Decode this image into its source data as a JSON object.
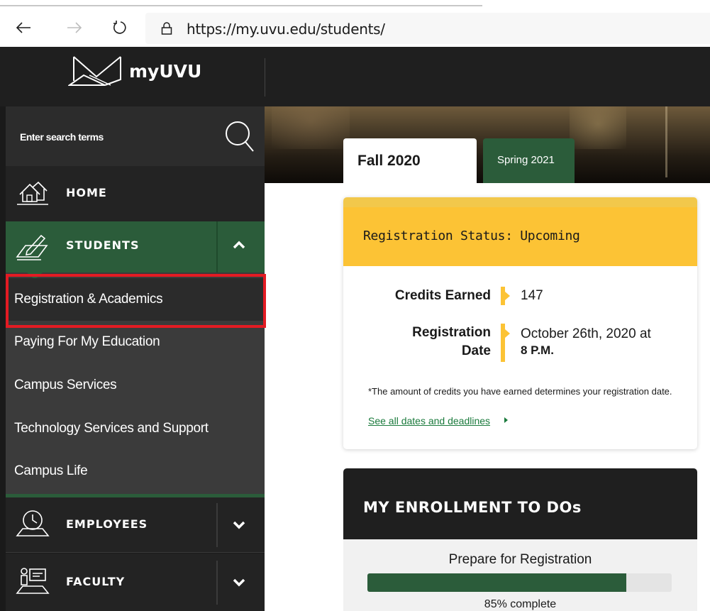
{
  "browser": {
    "url": "https://my.uvu.edu/students/"
  },
  "header": {
    "logo_text": "myUVU"
  },
  "sidebar": {
    "search_placeholder": "Enter search terms",
    "home_label": "HOME",
    "students_label": "STUDENTS",
    "employees_label": "EMPLOYEES",
    "faculty_label": "FACULTY",
    "submenu": [
      "Registration & Academics",
      "Paying For My Education",
      "Campus Services",
      "Technology Services and Support",
      "Campus Life"
    ]
  },
  "tabs": {
    "active": "Fall 2020",
    "other": "Spring 2021"
  },
  "registration": {
    "title": "Registration Status: Upcoming",
    "credits_label": "Credits Earned",
    "credits_value": "147",
    "date_label_1": "Registration",
    "date_label_2": "Date",
    "date_value_line1": "October 26th, 2020 at",
    "date_value_line2": "8 P.M.",
    "note": "*The amount of credits you have earned determines your registration date.",
    "link": "See all dates and deadlines"
  },
  "enrollment": {
    "title": "MY ENROLLMENT TO DOs",
    "task": "Prepare for Registration",
    "progress_percent": 85,
    "progress_text": "85% complete"
  },
  "colors": {
    "uvu_green": "#2b5c3a",
    "status_yellow": "#fcc335",
    "highlight_red": "#e31b23"
  }
}
